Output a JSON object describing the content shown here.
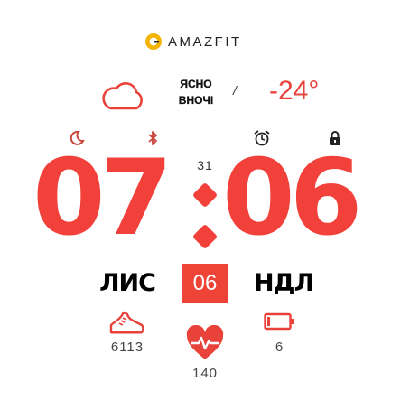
{
  "brand": {
    "name": "AMAZFIT"
  },
  "weather": {
    "line1": "ЯСНО",
    "line2": "ВНОЧІ",
    "wind": "/",
    "temperature": "-24°",
    "icon": "cloud-icon"
  },
  "status_icons": [
    "moon-icon",
    "bluetooth-icon",
    "alarm-icon",
    "lock-icon"
  ],
  "time": {
    "hours": "07",
    "minutes": "06",
    "seconds": "31"
  },
  "date": {
    "month": "ЛИС",
    "day": "06",
    "weekday": "НДЛ"
  },
  "stats": {
    "steps": "6113",
    "heart_rate": "140",
    "battery": "6"
  },
  "colors": {
    "accent": "#f1413a",
    "text": "#000000",
    "background": "#ffffff"
  }
}
